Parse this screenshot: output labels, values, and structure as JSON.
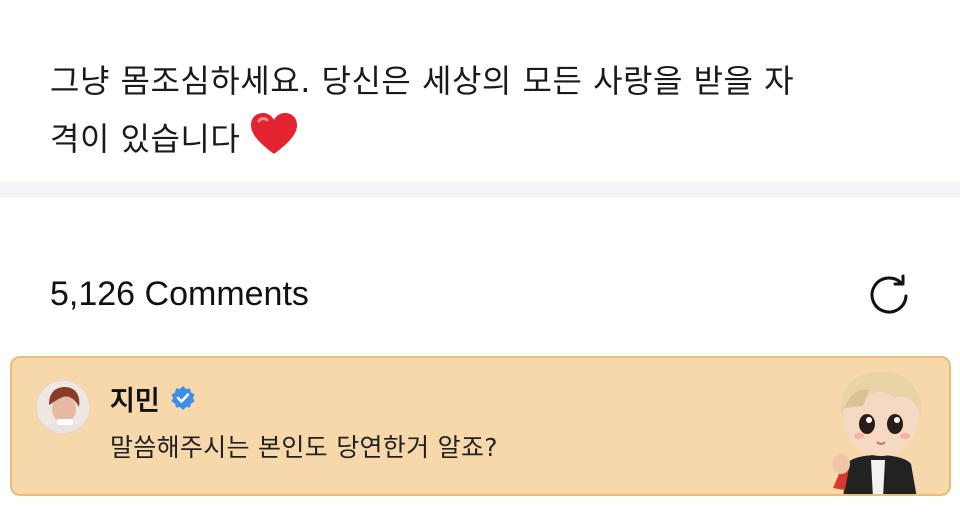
{
  "post": {
    "line1": "그냥 몸조심하세요.  당신은 세상의 모든 사랑을 받을 자",
    "line2": "격이 있습니다",
    "emoji": "heart-icon"
  },
  "comments": {
    "count_label": "5,126 Comments",
    "refresh_icon": "refresh-icon"
  },
  "featured_comment": {
    "author": "지민",
    "verified": true,
    "text": "말씀해주시는 본인도 당연한거 알죠?",
    "background": "#f7d8ab",
    "border": "#e8bc7d",
    "badge_color": "#3b8fe8"
  }
}
